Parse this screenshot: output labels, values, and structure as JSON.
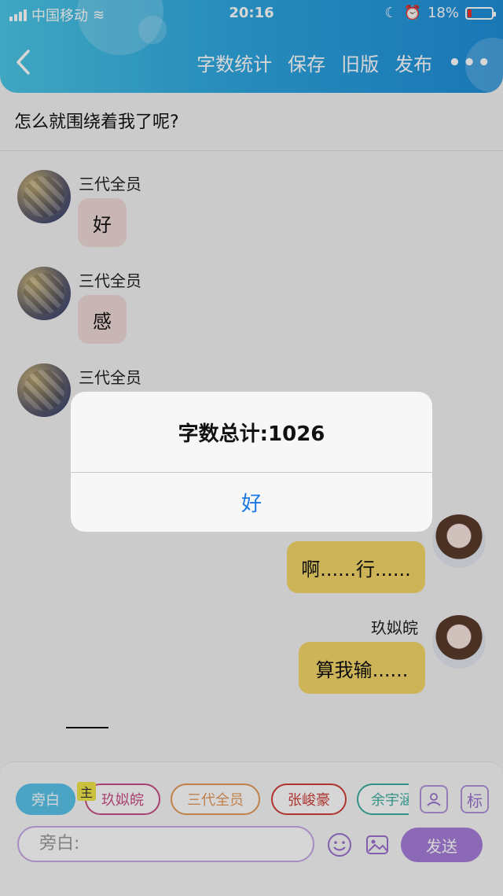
{
  "status_bar": {
    "carrier": "中国移动",
    "time": "20:16",
    "battery": "18%",
    "battery_level": 0.18
  },
  "header": {
    "back_icon": "chevron-left-icon",
    "actions": [
      "字数统计",
      "保存",
      "旧版",
      "发布"
    ],
    "more_icon": "more-horizontal-icon"
  },
  "title": "怎么就围绕着我了呢?",
  "messages": [
    {
      "sender": "三代全员",
      "text": "好"
    },
    {
      "sender": "三代全员",
      "text": "感"
    },
    {
      "sender": "三代全员",
      "text": ""
    },
    {
      "sender": "",
      "text": "啊......行......"
    },
    {
      "sender": "玖姒皖",
      "text": "算我输......"
    }
  ],
  "alert": {
    "message": "字数总计:1026",
    "button": "好"
  },
  "bottom": {
    "main_badge": "主",
    "chips": [
      "旁白",
      "玖姒皖",
      "三代全员",
      "张峻豪",
      "余宇涵"
    ],
    "icon_buttons": [
      "person-card-icon",
      "标"
    ],
    "input_placeholder": "旁白:",
    "send_label": "发送"
  },
  "colors": {
    "header": "#2fa8e0",
    "gold_bubble": "#f5d76a",
    "pink_bubble": "#efd9d7",
    "accent_purple": "#a77ed9",
    "alert_button": "#1a78e6"
  }
}
